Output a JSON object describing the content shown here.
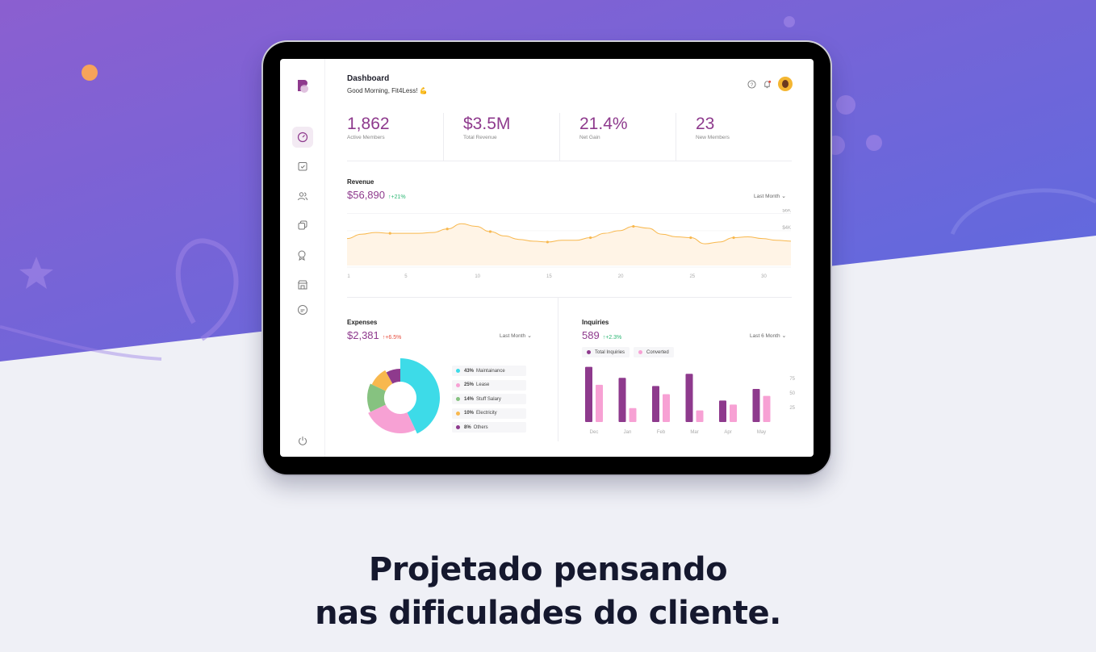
{
  "header": {
    "title": "Dashboard",
    "greeting": "Good Morning, Fit4Less! 💪"
  },
  "stats": [
    {
      "value": "1,862",
      "label": "Active Members"
    },
    {
      "value": "$3.5M",
      "label": "Total Revenue"
    },
    {
      "value": "21.4%",
      "label": "Net Gain"
    },
    {
      "value": "23",
      "label": "New Members"
    }
  ],
  "revenue": {
    "title": "Revenue",
    "value": "$56,890",
    "change": "↑+21%",
    "filter": "Last Month",
    "chart_data": {
      "type": "area",
      "x": [
        1,
        2,
        3,
        4,
        5,
        6,
        7,
        8,
        9,
        10,
        11,
        12,
        13,
        14,
        15,
        16,
        17,
        18,
        19,
        20,
        21,
        22,
        23,
        24,
        25,
        26,
        27,
        28,
        29,
        30,
        31,
        32
      ],
      "values": [
        3.1,
        3.6,
        3.8,
        3.7,
        3.7,
        3.7,
        3.8,
        4.2,
        4.8,
        4.5,
        3.9,
        3.4,
        3.0,
        2.8,
        2.7,
        2.9,
        2.9,
        3.2,
        3.7,
        4.0,
        4.5,
        4.3,
        3.6,
        3.3,
        3.2,
        2.5,
        2.7,
        3.2,
        3.3,
        3.1,
        2.9,
        2.8
      ],
      "y_ticks": [
        "$6K",
        "$4K",
        "$2K"
      ],
      "x_ticks": [
        "1",
        "5",
        "10",
        "15",
        "20",
        "25",
        "30"
      ],
      "ylim": [
        0,
        6.5
      ]
    }
  },
  "expenses": {
    "title": "Expenses",
    "value": "$2,381",
    "change": "↑+6.5%",
    "filter": "Last Month",
    "chart_data": {
      "type": "pie",
      "labels": [
        "Maintainance",
        "Lease",
        "Stuff Salary",
        "Electricity",
        "Others"
      ],
      "percents": [
        "43%",
        "25%",
        "14%",
        "10%",
        "8%"
      ],
      "values": [
        43,
        25,
        14,
        10,
        8
      ],
      "colors": [
        "#3ddbe8",
        "#f7a1d4",
        "#86c280",
        "#f8b84e",
        "#8e3a8d"
      ]
    }
  },
  "inquiries": {
    "title": "Inquiries",
    "value": "589",
    "change": "↑+2.3%",
    "filter": "Last 6 Month",
    "legend": [
      "Total Inquiries",
      "Converted"
    ],
    "chart_data": {
      "type": "bar",
      "categories": [
        "Dec",
        "Jan",
        "Feb",
        "Mar",
        "Apr",
        "May"
      ],
      "series": [
        {
          "name": "Total Inquiries",
          "values": [
            95,
            76,
            62,
            83,
            37,
            57
          ]
        },
        {
          "name": "Converted",
          "values": [
            64,
            24,
            48,
            20,
            30,
            45
          ]
        }
      ],
      "y_ticks": [
        "75",
        "50",
        "25"
      ],
      "ylim": [
        0,
        100
      ],
      "colors": [
        "#8e3a8d",
        "#f7a1d4"
      ]
    }
  },
  "sidebar_icons": [
    "dashboard-icon",
    "calendar-icon",
    "members-icon",
    "copy-icon",
    "badge-icon",
    "store-icon",
    "chat-icon"
  ],
  "headline": {
    "line1": "Projetado pensando",
    "line2": "nas dificulades do cliente."
  }
}
